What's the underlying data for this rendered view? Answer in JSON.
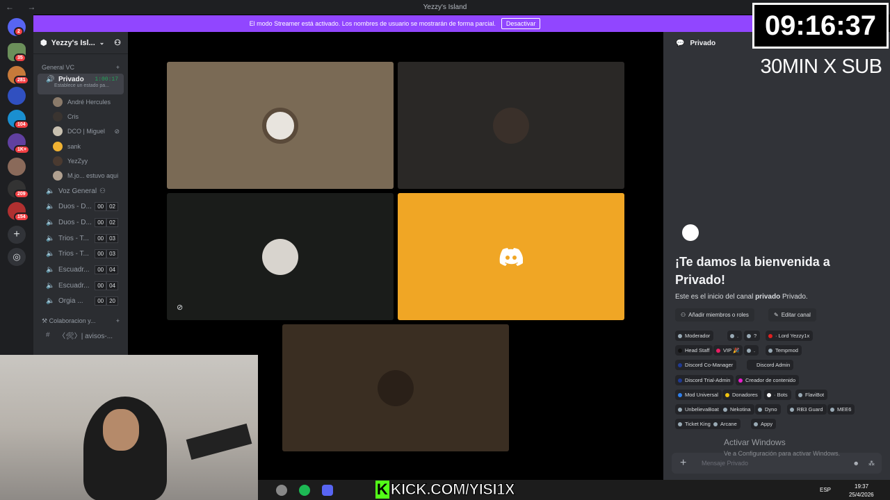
{
  "window": {
    "title": "Yezzy's Island",
    "nav": "← →"
  },
  "streamer_banner": {
    "text": "El modo Streamer está activado. Los nombres de usuario se mostrarán de forma parcial.",
    "button": "Desactivar"
  },
  "guild_badges": [
    "2",
    "35",
    "281",
    "104",
    "1K+",
    "209",
    "154"
  ],
  "server": {
    "name": "Yezzy's Isl..."
  },
  "categories": [
    {
      "label": "General VC"
    },
    {
      "label": "Colaboracion y..."
    }
  ],
  "active_channel": {
    "label": "Privado",
    "time": "1:00:17",
    "status": "Establece un estado pa..."
  },
  "members": [
    {
      "name": "André Hercules"
    },
    {
      "name": "Cris"
    },
    {
      "name": "DCO | Miguel"
    },
    {
      "name": "sank"
    },
    {
      "name": "YezZyy"
    },
    {
      "name": "M.jo...",
      "extra": "estuvo aqui"
    }
  ],
  "voice_channels": [
    {
      "label": "Voz General",
      "a": "",
      "b": ""
    },
    {
      "label": "Duos - D...",
      "a": "00",
      "b": "02"
    },
    {
      "label": "Duos - D...",
      "a": "00",
      "b": "02"
    },
    {
      "label": "Trios - T...",
      "a": "00",
      "b": "03"
    },
    {
      "label": "Trios - T...",
      "a": "00",
      "b": "03"
    },
    {
      "label": "Escuadr...",
      "a": "00",
      "b": "04"
    },
    {
      "label": "Escuadr...",
      "a": "00",
      "b": "04"
    },
    {
      "label": "Orgia ...",
      "a": "00",
      "b": "20"
    }
  ],
  "text_channel": {
    "label": "〈🛠〉| avisos-..."
  },
  "chat": {
    "header": "Privado",
    "welcome_line1": "¡Te damos la bienvenida a",
    "welcome_line2": "Privado!",
    "intro_pre": "Este es el inicio del canal ",
    "intro_bold": "privado",
    "intro_post": " Privado.",
    "add_members": "Añadir miembros o roles",
    "edit_channel": "Editar canal",
    "placeholder": "Mensaje Privado"
  },
  "roles": [
    {
      "label": "Moderador",
      "color": "#99aab5"
    },
    {
      "label": ".",
      "color": "#99aab5"
    },
    {
      "label": "?",
      "color": "#99aab5"
    },
    {
      "label": "· Lord Yezzy1x",
      "color": "#e02020"
    },
    {
      "label": "Head Staff",
      "color": "#111111"
    },
    {
      "label": "VIP 🎉",
      "color": "#e91e63"
    },
    {
      "label": ".",
      "color": "#99aab5"
    },
    {
      "label": "Tempmod",
      "color": "#99aab5"
    },
    {
      "label": "Discord Co-Manager",
      "color": "#1f3a93"
    },
    {
      "label": "Discord Admin",
      "color": "#232428"
    },
    {
      "label": "Discord Trial-Admin",
      "color": "#1f3a93"
    },
    {
      "label": "Creador de contenido",
      "color": "#e91ecc"
    },
    {
      "label": "Mod Universal",
      "color": "#2f80ed"
    },
    {
      "label": "Donadores",
      "color": "#f1c40f"
    },
    {
      "label": "· Bots",
      "color": "#ffffff"
    },
    {
      "label": "FlaviBot",
      "color": "#99aab5"
    },
    {
      "label": "UnbelievaBoat",
      "color": "#99aab5"
    },
    {
      "label": "Nekotina",
      "color": "#99aab5"
    },
    {
      "label": "Dyno",
      "color": "#99aab5"
    },
    {
      "label": "RB3 Guard",
      "color": "#99aab5"
    },
    {
      "label": "MEE6",
      "color": "#99aab5"
    },
    {
      "label": "Ticket King",
      "color": "#99aab5"
    },
    {
      "label": "Arcane",
      "color": "#99aab5"
    },
    {
      "label": "Appy",
      "color": "#99aab5"
    }
  ],
  "overlay": {
    "timer": "09:16:37",
    "subtitle": "30MIN  X SUB",
    "kick": "KICK.COM/YISI1X"
  },
  "windows": {
    "activate_title": "Activar Windows",
    "activate_sub": "Ve a Configuración para activar Windows."
  },
  "taskbar": {
    "lang": "ESP",
    "time": "19:37",
    "date": "25/4/2026"
  },
  "tile_colors": {
    "t1": "#7a6a55",
    "t2": "#2a2826",
    "t3": "#1a1c1a",
    "t4": "#f0a625",
    "t5": "#3a2e22"
  }
}
